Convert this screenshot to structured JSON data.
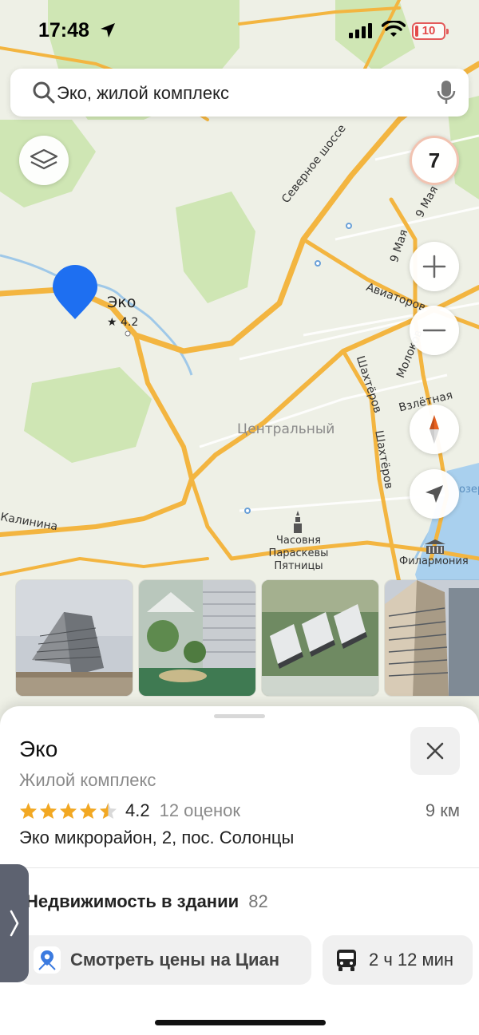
{
  "status_bar": {
    "time": "17:48",
    "battery": "10"
  },
  "search": {
    "query": "Эко, жилой комплекс"
  },
  "map": {
    "speed_badge": "7",
    "pin": {
      "name": "Эко",
      "rating": "★ 4.2"
    },
    "labels": {
      "severnoe": "Северное шоссе",
      "may9_a": "9 Мая",
      "may9_b": "9 Мая",
      "aviatorov": "Авиаторов",
      "molokova": "Молоков",
      "shakhterov_a": "Шахтёров",
      "shakhterov_b": "Шахтёров",
      "vzletnaya": "Взлётная",
      "district": "Центральный",
      "kalinina": "Калинина",
      "chapel": "Часовня Параскевы Пятницы",
      "philharmonic": "Филармония",
      "ozero": "озер"
    }
  },
  "place": {
    "title": "Эко",
    "category": "Жилой комплекс",
    "rating": "4.2",
    "rating_stars": 4.2,
    "rating_count": "12 оценок",
    "distance": "9 км",
    "address": "Эко микрорайон, 2, пос. Солонцы",
    "realty_label": "Недвижимость в здании",
    "realty_count": "82",
    "cian_button": "Смотреть цены на Циан",
    "transit_time": "2 ч 12 мин"
  },
  "colors": {
    "road": "#f3b540",
    "pin": "#1e6ff1",
    "star": "#f2a823",
    "map_bg": "#eef0e6",
    "park": "#cfe6b4"
  }
}
